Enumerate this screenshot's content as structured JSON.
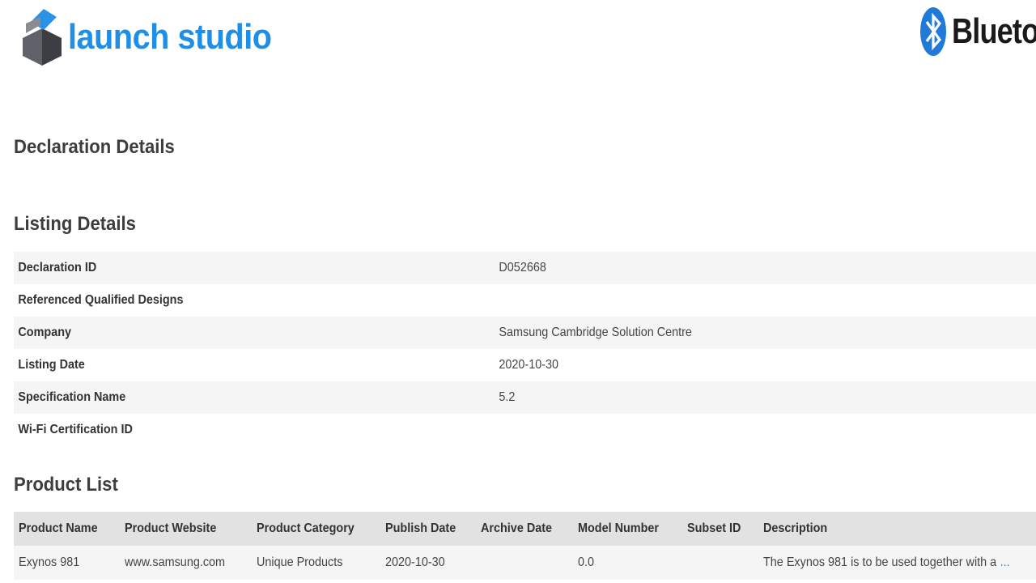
{
  "header": {
    "logo_text": "launch studio",
    "partner_logo_text": "Bluetoo"
  },
  "colors": {
    "brand_blue": "#1f8ee6",
    "header_row_bg": "#e2e2e2",
    "row_shade": "#f5f5f5"
  },
  "sections": {
    "declaration_title": "Declaration Details",
    "listing_title": "Listing Details",
    "product_title": "Product List"
  },
  "listing": [
    {
      "label": "Declaration ID",
      "value": "D052668"
    },
    {
      "label": "Referenced Qualified Designs",
      "value": ""
    },
    {
      "label": "Company",
      "value": "Samsung Cambridge Solution Centre"
    },
    {
      "label": "Listing Date",
      "value": "2020-10-30"
    },
    {
      "label": "Specification Name",
      "value": "5.2"
    },
    {
      "label": "Wi-Fi Certification ID",
      "value": ""
    }
  ],
  "products": {
    "columns": [
      "Product Name",
      "Product Website",
      "Product Category",
      "Publish Date",
      "Archive Date",
      "Model Number",
      "Subset ID",
      "Description"
    ],
    "rows": [
      {
        "name": "Exynos 981",
        "website": "www.samsung.com",
        "category": "Unique Products",
        "publish_date": "2020-10-30",
        "archive_date": "",
        "model_number": "0.0",
        "subset_id": "",
        "description": "The Exynos 981 is to be used together with a",
        "more": "..."
      }
    ]
  },
  "icons": {
    "logo_mark": "launch-studio-cube-icon",
    "partner_mark": "bluetooth-rune-icon"
  }
}
